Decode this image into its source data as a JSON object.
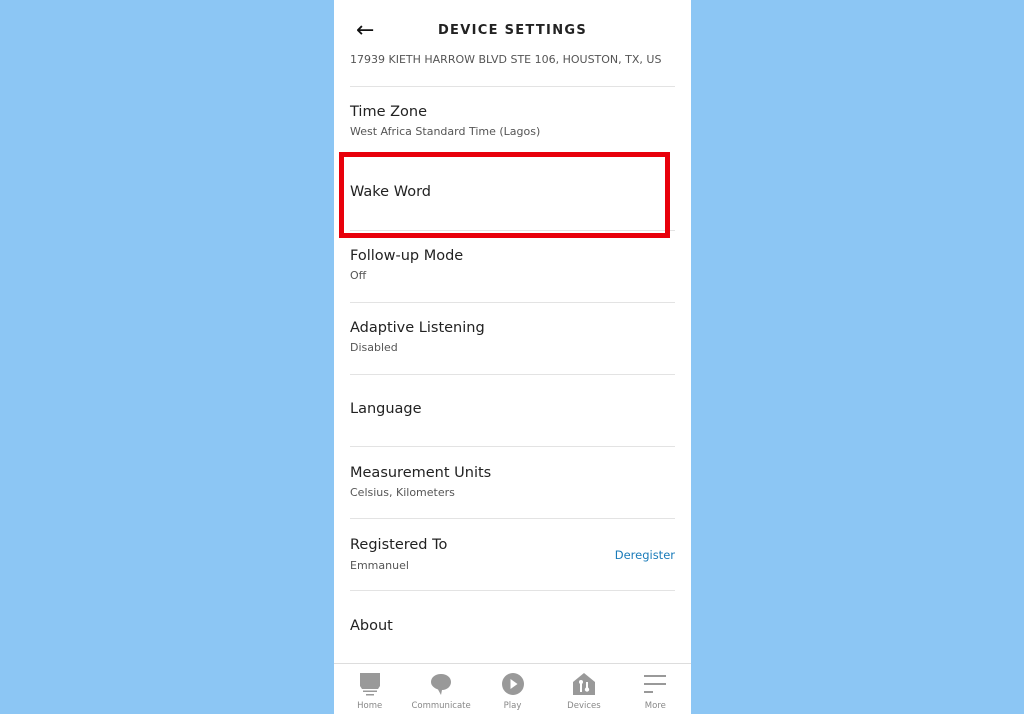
{
  "header": {
    "title": "DEVICE SETTINGS",
    "back_icon": "arrow-left-icon"
  },
  "address": "17939 KIETH HARROW BLVD STE 106, HOUSTON, TX, US",
  "rows": [
    {
      "title": "Time Zone",
      "subtitle": "West Africa Standard Time (Lagos)"
    },
    {
      "title": "Wake Word",
      "highlighted": true
    },
    {
      "title": "Follow-up Mode",
      "subtitle": "Off"
    },
    {
      "title": "Adaptive Listening",
      "subtitle": "Disabled"
    },
    {
      "title": "Language"
    },
    {
      "title": "Measurement Units",
      "subtitle": "Celsius, Kilometers"
    },
    {
      "title": "Registered To",
      "subtitle": "Emmanuel",
      "action": "Deregister"
    },
    {
      "title": "About"
    }
  ],
  "nav": [
    {
      "label": "Home",
      "icon": "home-icon"
    },
    {
      "label": "Communicate",
      "icon": "chat-bubble-icon"
    },
    {
      "label": "Play",
      "icon": "play-icon"
    },
    {
      "label": "Devices",
      "icon": "devices-house-icon"
    },
    {
      "label": "More",
      "icon": "menu-icon"
    }
  ],
  "colors": {
    "background": "#8cc6f4",
    "highlight": "#e8000b",
    "link": "#1a7bb9"
  }
}
